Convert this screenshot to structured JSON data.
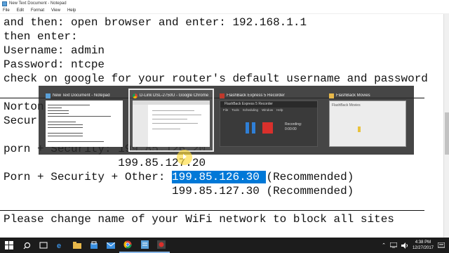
{
  "window": {
    "title": "New Text Document - Notepad"
  },
  "menu": [
    "File",
    "Edit",
    "Format",
    "View",
    "Help"
  ],
  "editor": {
    "lines": [
      "and then: open browser and enter: 192.168.1.1",
      "then enter:",
      "Username: admin",
      "Password: ntcpe",
      "check on google for your router's default username and password",
      "",
      "Norton",
      "Secur",
      "",
      "porn + Security: 199.85.126.20",
      "                 199.85.127.20",
      "",
      "Porn + Security + Other: ",
      "                         199.85.127.30 (Recommended)",
      "",
      "Please change name of your WiFi network to block all sites"
    ],
    "selected_text": "199.85.126.30 ",
    "after_selected": "(Recommended)"
  },
  "switcher": {
    "items": [
      {
        "label": "New Text Document - Notepad",
        "icon": "notepad-icon"
      },
      {
        "label": "D-Link DSL-2750U - Google Chrome",
        "icon": "chrome-icon"
      },
      {
        "label": "FlashBack Express 5 Recorder",
        "icon": "flashback-icon"
      },
      {
        "label": "FlashBack Movies",
        "icon": "folder-icon"
      }
    ],
    "active_index": 1,
    "recorder": {
      "title": "FlashBack Express 5 Recorder",
      "menu": [
        "File",
        "Tools",
        "Scheduling",
        "Window",
        "Help"
      ],
      "status_label": "Recording:",
      "time": "0:00:00"
    },
    "movies_title": "FlashBack Movies"
  },
  "taskbar": {
    "time": "4:38 PM",
    "date": "12/27/2017"
  },
  "colors": {
    "selection": "#0078d7",
    "taskbar": "#1c1c1c",
    "switcher": "#282828"
  }
}
